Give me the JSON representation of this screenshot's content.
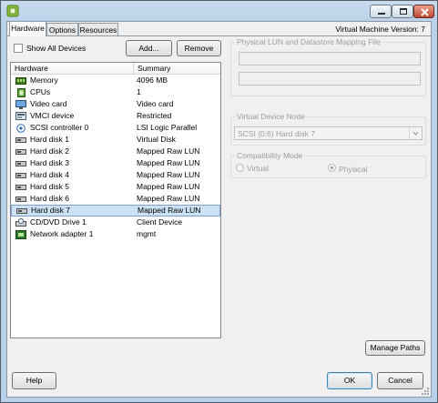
{
  "window": {
    "title": "",
    "vm_version": "Virtual Machine Version: 7",
    "caption_buttons": {
      "minimize": "minimize-icon",
      "maximize": "maximize-icon",
      "close": "close-icon"
    }
  },
  "tabs": [
    {
      "label": "Hardware",
      "active": true
    },
    {
      "label": "Options",
      "active": false
    },
    {
      "label": "Resources",
      "active": false
    }
  ],
  "show_all_devices": {
    "label": "Show All Devices",
    "checked": false
  },
  "buttons": {
    "add": "Add...",
    "remove": "Remove",
    "manage_paths": "Manage Paths",
    "help": "Help",
    "ok": "OK",
    "cancel": "Cancel"
  },
  "hardware_table": {
    "headers": [
      "Hardware",
      "Summary"
    ],
    "rows": [
      {
        "icon": "memory-icon",
        "name": "Memory",
        "summary": "4096 MB"
      },
      {
        "icon": "cpu-icon",
        "name": "CPUs",
        "summary": "1"
      },
      {
        "icon": "video-card-icon",
        "name": "Video card",
        "summary": "Video card"
      },
      {
        "icon": "vmci-device-icon",
        "name": "VMCI device",
        "summary": "Restricted"
      },
      {
        "icon": "scsi-controller-icon",
        "name": "SCSI controller 0",
        "summary": "LSI Logic Parallel"
      },
      {
        "icon": "hard-disk-icon",
        "name": "Hard disk 1",
        "summary": "Virtual Disk"
      },
      {
        "icon": "hard-disk-icon",
        "name": "Hard disk 2",
        "summary": "Mapped Raw LUN"
      },
      {
        "icon": "hard-disk-icon",
        "name": "Hard disk 3",
        "summary": "Mapped Raw LUN"
      },
      {
        "icon": "hard-disk-icon",
        "name": "Hard disk 4",
        "summary": "Mapped Raw LUN"
      },
      {
        "icon": "hard-disk-icon",
        "name": "Hard disk 5",
        "summary": "Mapped Raw LUN"
      },
      {
        "icon": "hard-disk-icon",
        "name": "Hard disk 6",
        "summary": "Mapped Raw LUN"
      },
      {
        "icon": "hard-disk-icon",
        "name": "Hard disk 7",
        "summary": "Mapped Raw LUN",
        "selected": true
      },
      {
        "icon": "cd-dvd-drive-icon",
        "name": "CD/DVD Drive 1",
        "summary": "Client Device"
      },
      {
        "icon": "network-adapter-icon",
        "name": "Network adapter 1",
        "summary": "mgmt"
      }
    ]
  },
  "physical_lun": {
    "legend": "Physical LUN and Datastore Mapping File",
    "field1": "",
    "field2": ""
  },
  "virtual_device_node": {
    "legend": "Virtual Device Node",
    "selected": "SCSI (0:6) Hard disk 7"
  },
  "compatibility_mode": {
    "legend": "Compatibility Mode",
    "options": [
      {
        "label": "Virtual",
        "checked": false
      },
      {
        "label": "Physical",
        "checked": true
      }
    ]
  },
  "colors": {
    "title_bar": "#b9d1ea",
    "selection": "#cce1f4",
    "selection_border": "#7da2ce",
    "close_button": "#c24832"
  }
}
